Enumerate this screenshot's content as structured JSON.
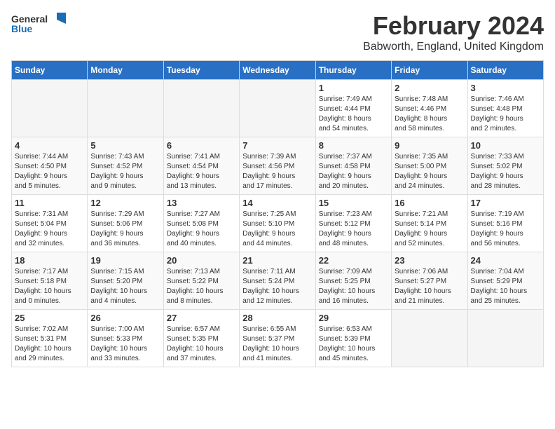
{
  "logo": {
    "general": "General",
    "blue": "Blue"
  },
  "title": "February 2024",
  "subtitle": "Babworth, England, United Kingdom",
  "days_header": [
    "Sunday",
    "Monday",
    "Tuesday",
    "Wednesday",
    "Thursday",
    "Friday",
    "Saturday"
  ],
  "weeks": [
    [
      {
        "day": "",
        "info": ""
      },
      {
        "day": "",
        "info": ""
      },
      {
        "day": "",
        "info": ""
      },
      {
        "day": "",
        "info": ""
      },
      {
        "day": "1",
        "info": "Sunrise: 7:49 AM\nSunset: 4:44 PM\nDaylight: 8 hours\nand 54 minutes."
      },
      {
        "day": "2",
        "info": "Sunrise: 7:48 AM\nSunset: 4:46 PM\nDaylight: 8 hours\nand 58 minutes."
      },
      {
        "day": "3",
        "info": "Sunrise: 7:46 AM\nSunset: 4:48 PM\nDaylight: 9 hours\nand 2 minutes."
      }
    ],
    [
      {
        "day": "4",
        "info": "Sunrise: 7:44 AM\nSunset: 4:50 PM\nDaylight: 9 hours\nand 5 minutes."
      },
      {
        "day": "5",
        "info": "Sunrise: 7:43 AM\nSunset: 4:52 PM\nDaylight: 9 hours\nand 9 minutes."
      },
      {
        "day": "6",
        "info": "Sunrise: 7:41 AM\nSunset: 4:54 PM\nDaylight: 9 hours\nand 13 minutes."
      },
      {
        "day": "7",
        "info": "Sunrise: 7:39 AM\nSunset: 4:56 PM\nDaylight: 9 hours\nand 17 minutes."
      },
      {
        "day": "8",
        "info": "Sunrise: 7:37 AM\nSunset: 4:58 PM\nDaylight: 9 hours\nand 20 minutes."
      },
      {
        "day": "9",
        "info": "Sunrise: 7:35 AM\nSunset: 5:00 PM\nDaylight: 9 hours\nand 24 minutes."
      },
      {
        "day": "10",
        "info": "Sunrise: 7:33 AM\nSunset: 5:02 PM\nDaylight: 9 hours\nand 28 minutes."
      }
    ],
    [
      {
        "day": "11",
        "info": "Sunrise: 7:31 AM\nSunset: 5:04 PM\nDaylight: 9 hours\nand 32 minutes."
      },
      {
        "day": "12",
        "info": "Sunrise: 7:29 AM\nSunset: 5:06 PM\nDaylight: 9 hours\nand 36 minutes."
      },
      {
        "day": "13",
        "info": "Sunrise: 7:27 AM\nSunset: 5:08 PM\nDaylight: 9 hours\nand 40 minutes."
      },
      {
        "day": "14",
        "info": "Sunrise: 7:25 AM\nSunset: 5:10 PM\nDaylight: 9 hours\nand 44 minutes."
      },
      {
        "day": "15",
        "info": "Sunrise: 7:23 AM\nSunset: 5:12 PM\nDaylight: 9 hours\nand 48 minutes."
      },
      {
        "day": "16",
        "info": "Sunrise: 7:21 AM\nSunset: 5:14 PM\nDaylight: 9 hours\nand 52 minutes."
      },
      {
        "day": "17",
        "info": "Sunrise: 7:19 AM\nSunset: 5:16 PM\nDaylight: 9 hours\nand 56 minutes."
      }
    ],
    [
      {
        "day": "18",
        "info": "Sunrise: 7:17 AM\nSunset: 5:18 PM\nDaylight: 10 hours\nand 0 minutes."
      },
      {
        "day": "19",
        "info": "Sunrise: 7:15 AM\nSunset: 5:20 PM\nDaylight: 10 hours\nand 4 minutes."
      },
      {
        "day": "20",
        "info": "Sunrise: 7:13 AM\nSunset: 5:22 PM\nDaylight: 10 hours\nand 8 minutes."
      },
      {
        "day": "21",
        "info": "Sunrise: 7:11 AM\nSunset: 5:24 PM\nDaylight: 10 hours\nand 12 minutes."
      },
      {
        "day": "22",
        "info": "Sunrise: 7:09 AM\nSunset: 5:25 PM\nDaylight: 10 hours\nand 16 minutes."
      },
      {
        "day": "23",
        "info": "Sunrise: 7:06 AM\nSunset: 5:27 PM\nDaylight: 10 hours\nand 21 minutes."
      },
      {
        "day": "24",
        "info": "Sunrise: 7:04 AM\nSunset: 5:29 PM\nDaylight: 10 hours\nand 25 minutes."
      }
    ],
    [
      {
        "day": "25",
        "info": "Sunrise: 7:02 AM\nSunset: 5:31 PM\nDaylight: 10 hours\nand 29 minutes."
      },
      {
        "day": "26",
        "info": "Sunrise: 7:00 AM\nSunset: 5:33 PM\nDaylight: 10 hours\nand 33 minutes."
      },
      {
        "day": "27",
        "info": "Sunrise: 6:57 AM\nSunset: 5:35 PM\nDaylight: 10 hours\nand 37 minutes."
      },
      {
        "day": "28",
        "info": "Sunrise: 6:55 AM\nSunset: 5:37 PM\nDaylight: 10 hours\nand 41 minutes."
      },
      {
        "day": "29",
        "info": "Sunrise: 6:53 AM\nSunset: 5:39 PM\nDaylight: 10 hours\nand 45 minutes."
      },
      {
        "day": "",
        "info": ""
      },
      {
        "day": "",
        "info": ""
      }
    ]
  ]
}
